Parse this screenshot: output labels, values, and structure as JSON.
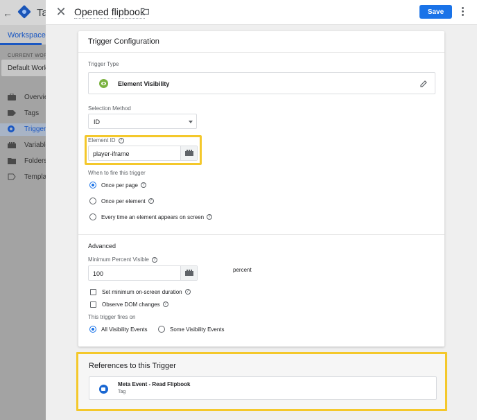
{
  "background": {
    "app_title": "Tag",
    "workspace_tab": "Workspace",
    "current_workspace_label": "CURRENT WORKSPACE",
    "current_workspace_value": "Default Workspace",
    "nav": [
      {
        "label": "Overview",
        "icon": "briefcase-icon"
      },
      {
        "label": "Tags",
        "icon": "tag-icon"
      },
      {
        "label": "Triggers",
        "icon": "trigger-icon",
        "active": true
      },
      {
        "label": "Variables",
        "icon": "variables-icon"
      },
      {
        "label": "Folders",
        "icon": "folder-icon"
      },
      {
        "label": "Templates",
        "icon": "template-icon"
      }
    ]
  },
  "header": {
    "title": "Opened flipbook",
    "save_label": "Save"
  },
  "trigger_config": {
    "title": "Trigger Configuration",
    "trigger_type_label": "Trigger Type",
    "trigger_type_value": "Element Visibility",
    "selection_method_label": "Selection Method",
    "selection_method_value": "ID",
    "element_id_label": "Element ID",
    "element_id_value": "player-iframe",
    "fire_label": "When to fire this trigger",
    "fire_options": [
      {
        "label": "Once per page",
        "selected": true
      },
      {
        "label": "Once per element",
        "selected": false
      },
      {
        "label": "Every time an element appears on screen",
        "selected": false
      }
    ],
    "advanced_title": "Advanced",
    "min_percent_label": "Minimum Percent Visible",
    "min_percent_value": "100",
    "min_percent_unit": "percent",
    "checkbox_duration": "Set minimum on-screen duration",
    "checkbox_dom": "Observe DOM changes",
    "fires_on_label": "This trigger fires on",
    "fires_on_options": [
      {
        "label": "All Visibility Events",
        "selected": true
      },
      {
        "label": "Some Visibility Events",
        "selected": false
      }
    ]
  },
  "references": {
    "title": "References to this Trigger",
    "items": [
      {
        "name": "Meta Event - Read Flipbook",
        "type": "Tag"
      }
    ]
  },
  "colors": {
    "accent": "#1a73e8",
    "highlight": "#f4c82b",
    "element_visibility_icon": "#7cb342"
  }
}
